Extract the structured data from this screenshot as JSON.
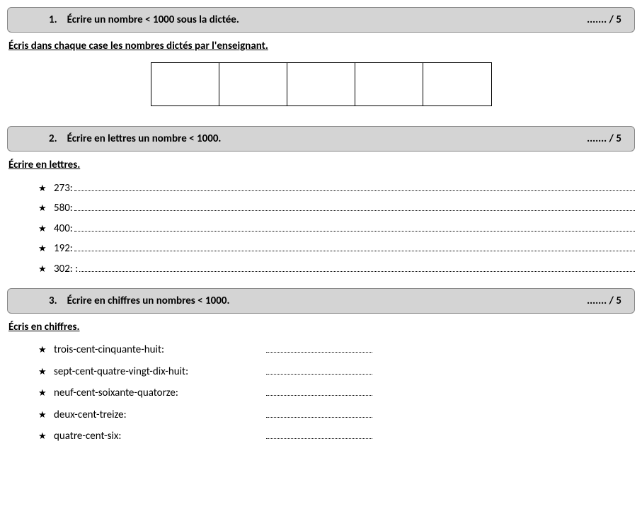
{
  "sections": [
    {
      "num": "1.",
      "title": "Écrire un nombre < 1000 sous la dictée.",
      "score": "....... / 5",
      "instruction": "Écris dans chaque case les nombres dictés par l'enseignant."
    },
    {
      "num": "2.",
      "title": "Écrire en lettres un nombre < 1000.",
      "score": "....... / 5",
      "instruction": "Écrire en lettres.",
      "items": [
        "273: ",
        "580:",
        "400:",
        "192:",
        "302: :"
      ]
    },
    {
      "num": "3.",
      "title": "Écrire en chiffres un nombres < 1000.",
      "score": "....... / 5",
      "instruction": "Écris en chiffres.",
      "items": [
        "trois-cent-cinquante-huit:",
        "sept-cent-quatre-vingt-dix-huit:",
        "neuf-cent-soixante-quatorze:",
        "deux-cent-treize:",
        "quatre-cent-six:"
      ]
    }
  ],
  "star": "★"
}
